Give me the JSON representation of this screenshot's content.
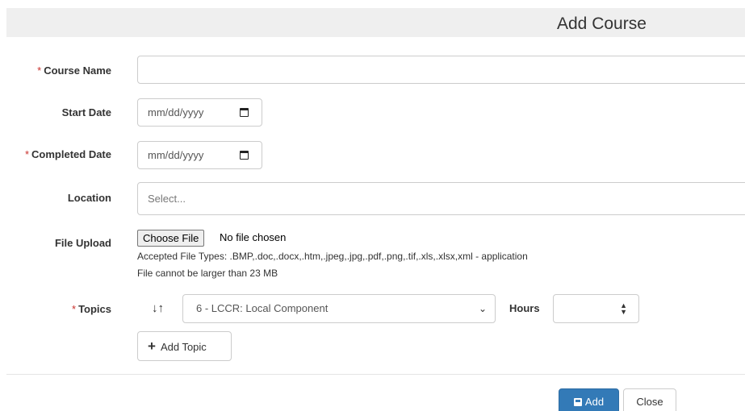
{
  "modal": {
    "title": "Add Course"
  },
  "form": {
    "required_marker": "*",
    "course_name": {
      "label": "Course Name",
      "value": ""
    },
    "start_date": {
      "label": "Start Date",
      "placeholder": "mm/dd/yyyy"
    },
    "completed_date": {
      "label": "Completed Date",
      "placeholder": "mm/dd/yyyy"
    },
    "location": {
      "label": "Location",
      "placeholder": "Select..."
    },
    "file_upload": {
      "label": "File Upload",
      "button_label": "Choose File",
      "status": "No file chosen",
      "accepted_types": "Accepted File Types: .BMP,.doc,.docx,.htm,.jpeg,.jpg,.pdf,.png,.tif,.xls,.xlsx,xml - application",
      "size_limit": "File cannot be larger than 23 MB"
    },
    "topics": {
      "label": "Topics",
      "selected": "6 - LCCR: Local Component",
      "hours_label": "Hours",
      "hours_value": "",
      "add_topic_label": "Add Topic"
    }
  },
  "footer": {
    "add_label": "Add",
    "close_label": "Close"
  },
  "colors": {
    "primary": "#337ab7",
    "required": "#c9302c",
    "header_bg": "#efefef"
  },
  "icons": {
    "sort": "sort-icon",
    "calendar": "calendar-icon",
    "plus": "plus-icon",
    "save": "save-icon",
    "chevron": "chevron-down-icon",
    "spinner": "spinner-icon"
  }
}
